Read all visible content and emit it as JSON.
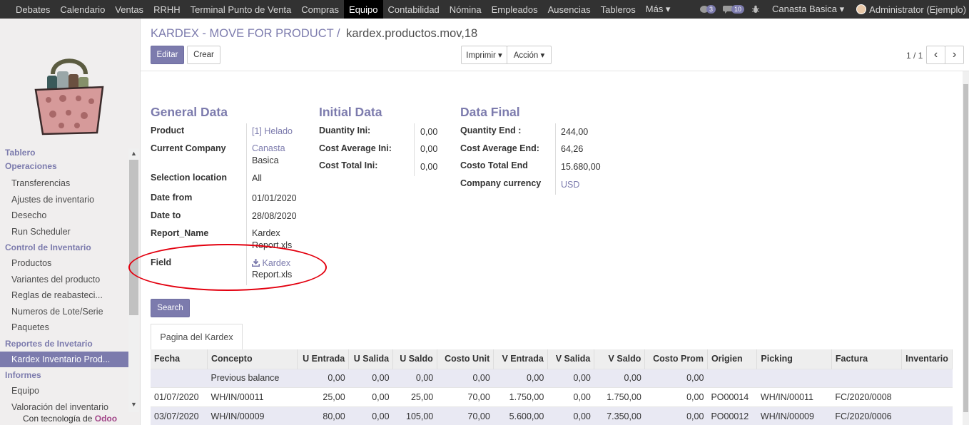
{
  "topbar": {
    "menu": [
      "Debates",
      "Calendario",
      "Ventas",
      "RRHH",
      "Terminal Punto de Venta",
      "Compras",
      "Equipo",
      "Contabilidad",
      "Nómina",
      "Empleados",
      "Ausencias",
      "Tableros",
      "Más ▾"
    ],
    "active_menu": "Equipo",
    "chat_count": "3",
    "messages_count": "10",
    "company": "Canasta Basica ▾",
    "user": "Administrator (Ejemplo)"
  },
  "sidebar": {
    "sections": [
      {
        "title": "Tablero",
        "items": []
      },
      {
        "title": "Operaciones",
        "items": [
          "Transferencias",
          "Ajustes de inventario",
          "Desecho",
          "Run Scheduler"
        ]
      },
      {
        "title": "Control de Inventario",
        "items": [
          "Productos",
          "Variantes del producto",
          "Reglas de reabasteci...",
          "Numeros de Lote/Serie",
          "Paquetes"
        ]
      },
      {
        "title": "Reportes de Invetario",
        "items": [
          "Kardex Inventario Prod..."
        ]
      },
      {
        "title": "Informes",
        "items": [
          "Equipo",
          "Valoración del inventario"
        ]
      }
    ],
    "active_item": "Kardex Inventario Prod...",
    "powered_prefix": "Con tecnología de",
    "powered_brand": "Odoo"
  },
  "control_panel": {
    "breadcrumb_parent": "KARDEX - MOVE FOR PRODUCT",
    "breadcrumb_sep": "/",
    "breadcrumb_current": "kardex.productos.mov,18",
    "edit_label": "Editar",
    "create_label": "Crear",
    "print_label": "Imprimir ▾",
    "action_label": "Acción ▾",
    "pager": "1 / 1",
    "prev": "‹",
    "next": "›"
  },
  "form": {
    "general": {
      "title": "General Data",
      "product_label": "Product",
      "product_value": "[1] Helado",
      "company_label": "Current Company",
      "company_value_1": "Canasta",
      "company_value_2": "Basica",
      "location_label": "Selection location",
      "location_value": "All",
      "date_from_label": "Date from",
      "date_from_value": "01/01/2020",
      "date_to_label": "Date to",
      "date_to_value": "28/08/2020",
      "report_name_label": "Report_Name",
      "report_name_1": "Kardex",
      "report_name_2": "Report.xls",
      "field_label": "Field",
      "field_link": "Kardex",
      "field_value_2": "Report.xls"
    },
    "initial": {
      "title": "Initial Data",
      "qty_label": "Duantity Ini:",
      "qty_value": "0,00",
      "cost_avg_label": "Cost Average Ini:",
      "cost_avg_value": "0,00",
      "cost_total_label": "Cost Total Ini:",
      "cost_total_value": "0,00"
    },
    "final": {
      "title": "Data Final",
      "qty_label": "Quantity End :",
      "qty_value": "244,00",
      "cost_avg_label": "Cost Average End:",
      "cost_avg_value": "64,26",
      "cost_total_label": "Costo Total End",
      "cost_total_value": "15.680,00",
      "currency_label": "Company currency",
      "currency_value": "USD"
    },
    "search_label": "Search",
    "tab_label": "Pagina del Kardex"
  },
  "table": {
    "columns": [
      "Fecha",
      "Concepto",
      "U Entrada",
      "U Salida",
      "U Saldo",
      "Costo Unit",
      "V Entrada",
      "V Salida",
      "V Saldo",
      "Costo Prom",
      "Origien",
      "Picking",
      "Factura",
      "Inventario"
    ],
    "rows": [
      [
        "",
        "Previous balance",
        "0,00",
        "0,00",
        "0,00",
        "0,00",
        "0,00",
        "0,00",
        "0,00",
        "0,00",
        "",
        "",
        "",
        ""
      ],
      [
        "01/07/2020",
        "WH/IN/00011",
        "25,00",
        "0,00",
        "25,00",
        "70,00",
        "1.750,00",
        "0,00",
        "1.750,00",
        "0,00",
        "PO00014",
        "WH/IN/00011",
        "FC/2020/0008",
        ""
      ],
      [
        "03/07/2020",
        "WH/IN/00009",
        "80,00",
        "0,00",
        "105,00",
        "70,00",
        "5.600,00",
        "0,00",
        "7.350,00",
        "0,00",
        "PO00012",
        "WH/IN/00009",
        "FC/2020/0006",
        ""
      ]
    ]
  }
}
